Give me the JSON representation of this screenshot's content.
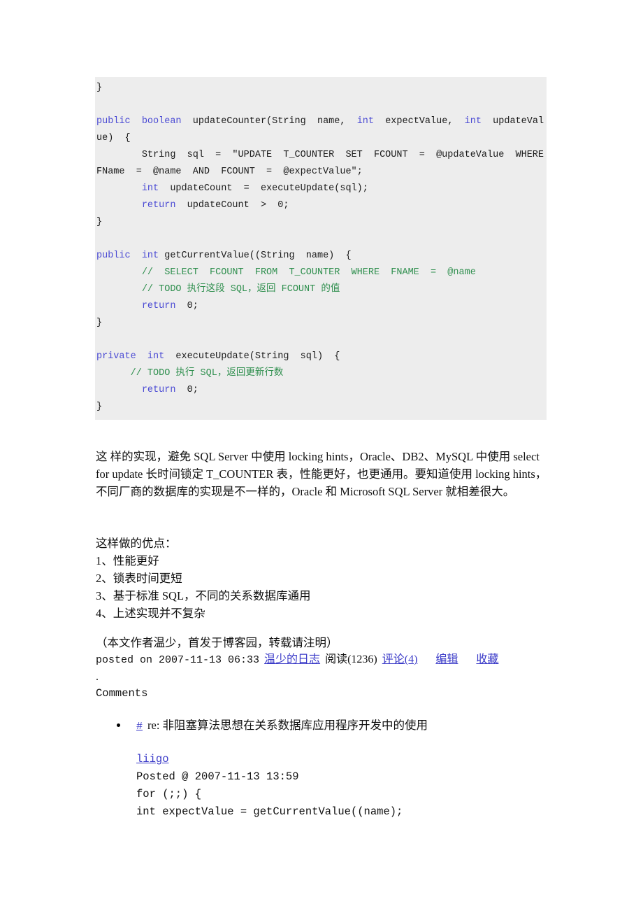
{
  "code_block": {
    "lines": [
      [
        {
          "t": "}",
          "c": "txt"
        }
      ],
      [
        {
          "t": "",
          "c": "txt"
        }
      ],
      [
        {
          "t": "public",
          "c": "kw"
        },
        {
          "t": "  ",
          "c": "txt"
        },
        {
          "t": "boolean",
          "c": "kw"
        },
        {
          "t": "  updateCounter(String  name,  ",
          "c": "txt"
        },
        {
          "t": "int",
          "c": "kw"
        },
        {
          "t": "  expectValue,  ",
          "c": "txt"
        },
        {
          "t": "int",
          "c": "kw"
        },
        {
          "t": "  updateValue)  {",
          "c": "txt"
        }
      ],
      [
        {
          "t": "        String  sql  =  ″UPDATE  T_COUNTER  SET  FCOUNT  =  @updateValue  WHERE  FName  =  @name  AND  FCOUNT  =  @expectValue″;",
          "c": "txt"
        }
      ],
      [
        {
          "t": "        ",
          "c": "txt"
        },
        {
          "t": "int",
          "c": "kw"
        },
        {
          "t": "  updateCount  =  executeUpdate(sql);",
          "c": "txt"
        }
      ],
      [
        {
          "t": "        ",
          "c": "txt"
        },
        {
          "t": "return",
          "c": "kw"
        },
        {
          "t": "  updateCount  >  0;",
          "c": "txt"
        }
      ],
      [
        {
          "t": "}",
          "c": "txt"
        }
      ],
      [
        {
          "t": "",
          "c": "txt"
        }
      ],
      [
        {
          "t": "public",
          "c": "kw"
        },
        {
          "t": "  ",
          "c": "txt"
        },
        {
          "t": "int",
          "c": "kw"
        },
        {
          "t": " getCurrentValue((String  name)  {",
          "c": "txt"
        }
      ],
      [
        {
          "t": "        //  SELECT  FCOUNT  FROM  T_COUNTER  WHERE  FNAME  =  @name",
          "c": "cmt"
        }
      ],
      [
        {
          "t": "        // TODO 执行这段 SQL，返回 FCOUNT 的值",
          "c": "cmt"
        }
      ],
      [
        {
          "t": "        ",
          "c": "txt"
        },
        {
          "t": "return",
          "c": "kw"
        },
        {
          "t": "  0;",
          "c": "txt"
        }
      ],
      [
        {
          "t": "}",
          "c": "txt"
        }
      ],
      [
        {
          "t": "",
          "c": "txt"
        }
      ],
      [
        {
          "t": "private",
          "c": "kw"
        },
        {
          "t": "  ",
          "c": "txt"
        },
        {
          "t": "int",
          "c": "kw"
        },
        {
          "t": "  executeUpdate(String  sql)  {",
          "c": "txt"
        }
      ],
      [
        {
          "t": "      // TODO 执行 SQL，返回更新行数",
          "c": "cmt"
        }
      ],
      [
        {
          "t": "        ",
          "c": "txt"
        },
        {
          "t": "return",
          "c": "kw"
        },
        {
          "t": "  0;",
          "c": "txt"
        }
      ],
      [
        {
          "t": "}",
          "c": "txt"
        }
      ]
    ]
  },
  "paragraph": "这 样的实现，避免 SQL Server 中使用 locking hints，Oracle、DB2、MySQL 中使用 select for update 长时间锁定 T_COUNTER 表，性能更好，也更通用。要知道使用 locking hints，不同厂商的数据库的实现是不一样的，Oracle 和 Microsoft SQL Server 就相差很大。",
  "advantages": {
    "heading": "这样做的优点：",
    "items": [
      "1、性能更好",
      "2、锁表时间更短",
      "3、基于标准 SQL，不同的关系数据库通用",
      "4、上述实现并不复杂"
    ]
  },
  "author_note": "（本文作者温少，首发于博客园，转载请注明）",
  "posted": {
    "prefix": "posted on 2007-11-13 06:33",
    "blog_link": "温少的日志",
    "read_count": "阅读(1236)",
    "comments_link": "评论(4)",
    "edit_link": "编辑",
    "favorite_link": "收藏"
  },
  "dot": ".",
  "comments_heading": "Comments",
  "comments": [
    {
      "hash": "#",
      "title": "re: 非阻塞算法思想在关系数据库应用程序开发中的使用",
      "author": "liigo",
      "posted_at": "Posted @ 2007-11-13 13:59",
      "code_lines": [
        "for (;;) {",
        "int expectValue = getCurrentValue((name);"
      ]
    }
  ],
  "colors": {
    "code_background": "#ededed",
    "keyword": "#4b4bd4",
    "comment": "#2f8f4e",
    "link": "#3a3ac8",
    "text": "#111111",
    "page_background": "#ffffff"
  }
}
